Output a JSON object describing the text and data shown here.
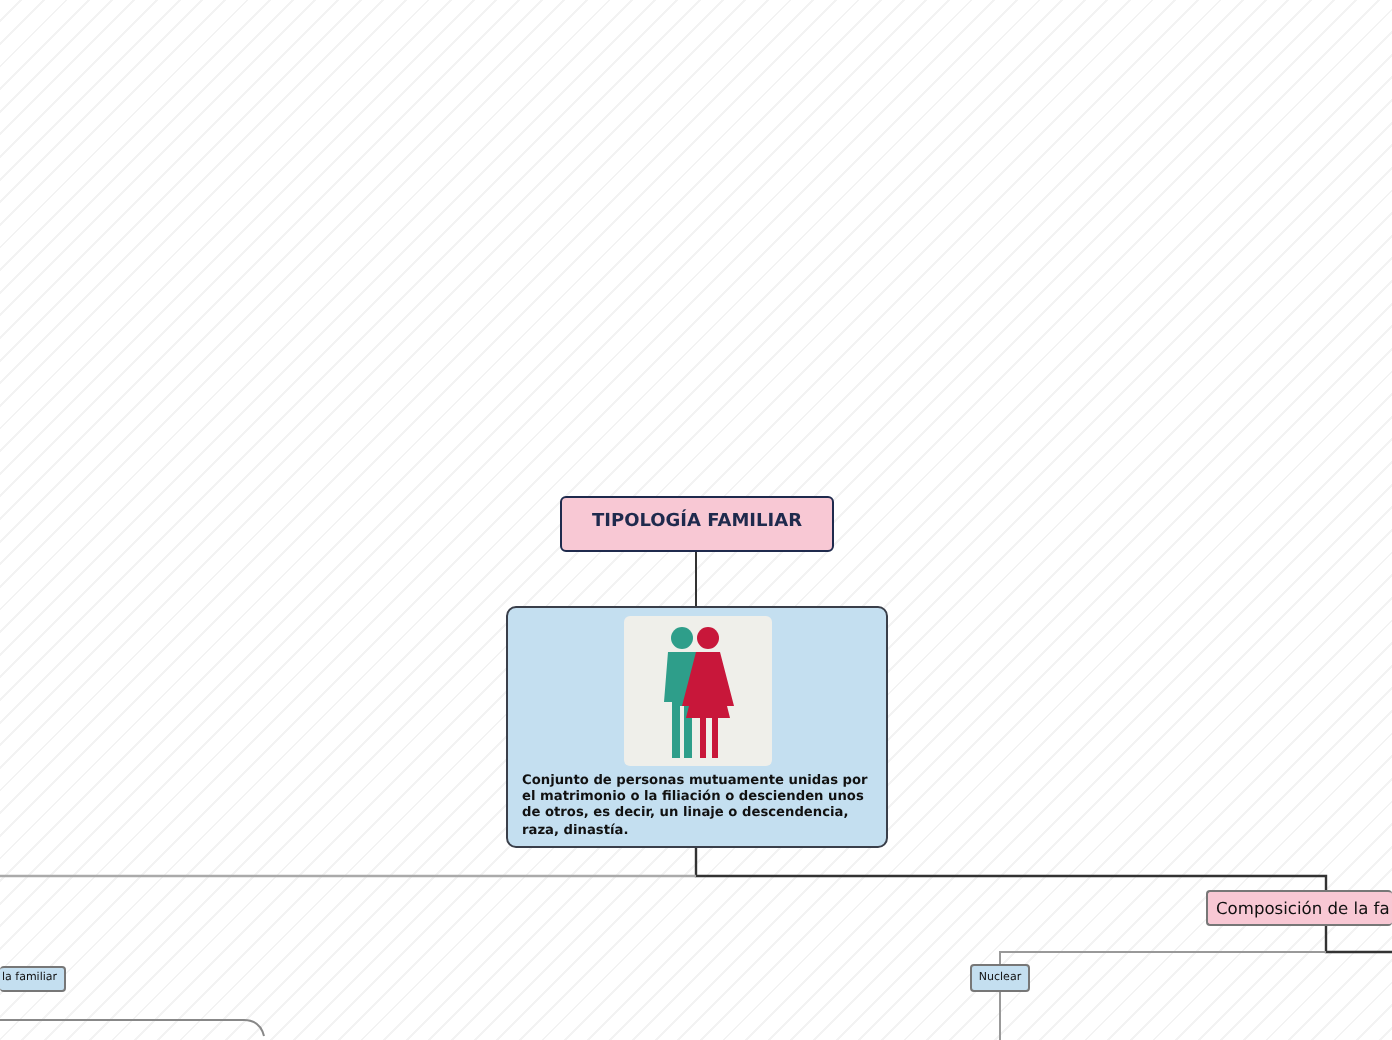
{
  "root_topic": {
    "title": "TIPOLOGÍA FAMILIAR"
  },
  "definition_card": {
    "text": "Conjunto de personas mutuamente unidas por el matrimonio o la filiación o descienden unos de otros, es decir, un linaje o descendencia, raza, dinastía."
  },
  "topics": [
    {
      "title": "la familiar",
      "kind": "left"
    },
    {
      "title": "Composición de la fa",
      "kind": "main"
    },
    {
      "title": "Nuclear",
      "kind": "sub"
    }
  ]
}
